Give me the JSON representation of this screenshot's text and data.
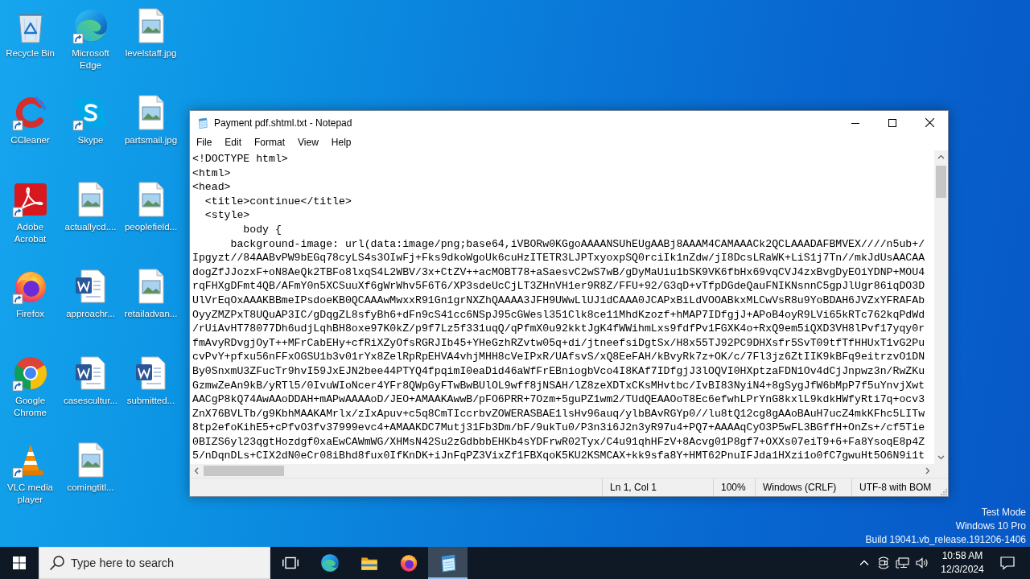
{
  "desktop": {
    "icons": [
      {
        "label": "Recycle Bin",
        "kind": "recycle-bin",
        "shortcut": false
      },
      {
        "label": "CCleaner",
        "kind": "ccleaner",
        "shortcut": true
      },
      {
        "label": "Adobe Acrobat",
        "kind": "acrobat",
        "shortcut": true
      },
      {
        "label": "Firefox",
        "kind": "firefox",
        "shortcut": true
      },
      {
        "label": "Google Chrome",
        "kind": "chrome",
        "shortcut": true
      },
      {
        "label": "VLC media player",
        "kind": "vlc",
        "shortcut": true
      },
      {
        "label": "Microsoft Edge",
        "kind": "edge",
        "shortcut": true
      },
      {
        "label": "Skype",
        "kind": "skype",
        "shortcut": true
      },
      {
        "label": "actuallycd....",
        "kind": "image-file",
        "shortcut": false
      },
      {
        "label": "approachr...",
        "kind": "word-file",
        "shortcut": false
      },
      {
        "label": "casescultur...",
        "kind": "word-file",
        "shortcut": false
      },
      {
        "label": "comingtitl...",
        "kind": "image-file",
        "shortcut": false
      },
      {
        "label": "levelstaff.jpg",
        "kind": "image-file",
        "shortcut": false
      },
      {
        "label": "partsmail.jpg",
        "kind": "image-file",
        "shortcut": false
      },
      {
        "label": "peoplefield...",
        "kind": "image-file",
        "shortcut": false
      },
      {
        "label": "retailadvan...",
        "kind": "image-file",
        "shortcut": false
      },
      {
        "label": "submitted...",
        "kind": "word-file",
        "shortcut": false
      }
    ],
    "watermark": [
      "Test Mode",
      "Windows 10 Pro",
      "Build 19041.vb_release.191206-1406"
    ]
  },
  "window": {
    "title": "Payment pdf.shtml.txt - Notepad",
    "menu": [
      "File",
      "Edit",
      "Format",
      "View",
      "Help"
    ],
    "lines": [
      "<!DOCTYPE html>",
      "<html>",
      "<head>",
      "  <title>continue</title>",
      "  <style>",
      "        body {",
      "      background-image: url(data:image/png;base64,iVBORw0KGgoAAAANSUhEUgAABj8AAAM4CAMAAACk2QCLAAADAFBMVEX////n5ub+/",
      "Ipgyzt//84AABvPW9bEGq78cyLS4s3OIwFj+Fks9dkoWgoUk6cuHzITETR3LJPTxyoxpSQ0rciIk1nZdw/jI8DcsLRaWK+LiS1j7Tn//mkJdUsAACAA",
      "dogZfJJozxF+oN8AeQk2TBFo8lxqS4L2WBV/3x+CtZV++acMOBT78+aSaesvC2wS7wB/gDyMaUiu1bSK9VK6fbHx69vqCVJ4zxBvgDyEOiYDNP+MOU4",
      "rqFHXgDFmt4QB/AFmY0n5XCSuuXf6gWrWhv5F6T6/XP3sdeUcCjLT3ZHnVH1er9R8Z/FFU+92/G3qD+vTfpDGdeQauFNIKNsnnC5gpJlUgr86iqDO3D",
      "UlVrEqOxAAAKBBmeIPsdoeKB0QCAAAwMwxxR91Gn1grNXZhQAAAA3JFH9UWwLlUJ1dCAAA0JCAPxBiLdVOOABkxMLCwVsR8u9YoBDAH6JVZxYFRAFAb",
      "OyyZMZPxT8UQuAP3IC/gDqgZL8sfyBh6+dFn9cS41cc6NSpJ95cGWesl351Clk8ce11MhdKzozf+hMAP7IDfgjJ+APoB4oyR9LVi65kRTc762kqPdWd",
      "/rUiAvHT78077Dh6udjLqhBH8oxe97K0kZ/p9f7Lz5f331uqQ/qPfmX0u92kktJgK4fWWihmLxs9fdfPv1FGXK4o+RxQ9em5iQXD3VH8lPvf17yqy0r",
      "fmAvyRDvgjOyT++MFrCabEHy+cfRiXZyOfsRGRJIb45+YHeGzhRZvtw05q+di/jtneefsiDgtSx/H8x55TJ92PC9DHXsfr5SvT09tfTfHHUxT1vG2Pu",
      "cvPvY+pfxu56nFFxOGSU1b3v01rYx8ZelRpRpEHVA4vhjMHH8cVeIPxR/UAfsvS/xQ8EeFAH/kBvyRk7z+OK/c/7Fl3jz6ZtIIK9kBFq9eitrzvO1DN",
      "By0SnxmU3ZFucTr9hvI59JxEJN2bee44PTYQ4fpqimI0eaDid46aWfFrEBniogbVco4I8KAf7IDfgjJ3lOQVI0HXptzaFDN1Ov4dCjJnpwz3n/RwZKu",
      "GzmwZeAn9kB/yRTl5/0IvuWIoNcer4YFr8QWpGyFTwBwBUlOL9wff8jNSAH/lZ8zeXDTxCKsMHvtbc/IvBI83NyiN4+8gSygJfW6bMpP7f5uYnvjXwt",
      "AACgP8kQ74AwAAoDDAH+mAPwAAAAoD/JEO+AMAAKAwwB/pFO6PRR+7Ozm+5guPZ1wm2/TUdQEAAOoT8Ec6efwhLPrYnG8kxlL9kdkHWfyRti7q+ocv3",
      "ZnX76BVLTb/g9KbhMAAKAMrlx/zIxApuv+c5q8CmTIccrbvZOWERASBAE1lsHv96auq/ylbBAvRGYp0//lu8tQ12cg8gAAoBAuH7ucZ4mkKFhc5LITw",
      "8tp2efoKihE5+cPfvO3fv37999evc4+AMAAKDC7Mutj31Fb3Dm/bF/9ukTu0/P3n3i6J2n3yR97u4+PQ7+AAAAqCyO3P5wFL3BGffH+OnZs+/cf5Tie",
      "0BIZS6yl23qgtHozdgf0xaEwCAWmWG/XHMsN42Su2zGdbbbEHKb4sYDFrwR02Tyx/C4u91qhHFzV+8Acvg01P8gf7+OXXs07eiT9+6+Fa8YsoqE8p4Z",
      "5/nDqnDLs+CIX2dN0eCr08iBhd8fux0IfKnDK+iJnFqPZ3VixZf1FBXqoK5KU2KSMCAX+kk9sfa8Y+HMT62PnuIFJda1HXzi1o0fC7gwuHt5O6N9i1t"
    ],
    "status_bar": [
      "Ln 1, Col 1",
      "100%",
      "Windows (CRLF)",
      "UTF-8 with BOM"
    ]
  },
  "taskbar": {
    "search": {
      "placeholder": "Type here to search"
    },
    "apps": [
      {
        "kind": "task-view",
        "selected": false
      },
      {
        "kind": "edge",
        "selected": false
      },
      {
        "kind": "explorer",
        "selected": false
      },
      {
        "kind": "firefox",
        "selected": false
      },
      {
        "kind": "notepad",
        "selected": true
      }
    ],
    "clock": {
      "time": "10:58 AM",
      "date": "12/3/2024"
    }
  }
}
